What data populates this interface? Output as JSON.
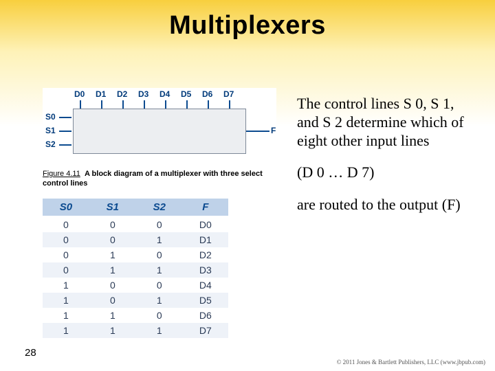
{
  "slide": {
    "title": "Multiplexers",
    "number": "28",
    "copyright": "© 2011 Jones & Bartlett Publishers, LLC (www.jbpub.com)"
  },
  "diagram": {
    "data_inputs": [
      "D0",
      "D1",
      "D2",
      "D3",
      "D4",
      "D5",
      "D6",
      "D7"
    ],
    "select_inputs": [
      "S0",
      "S1",
      "S2"
    ],
    "output_label": "F"
  },
  "caption": {
    "fig_label": "Figure 4.11",
    "text": "A block diagram of a multiplexer with three select control lines"
  },
  "truth_table": {
    "headers": [
      "S0",
      "S1",
      "S2",
      "F"
    ],
    "rows": [
      [
        "0",
        "0",
        "0",
        "D0"
      ],
      [
        "0",
        "0",
        "1",
        "D1"
      ],
      [
        "0",
        "1",
        "0",
        "D2"
      ],
      [
        "0",
        "1",
        "1",
        "D3"
      ],
      [
        "1",
        "0",
        "0",
        "D4"
      ],
      [
        "1",
        "0",
        "1",
        "D5"
      ],
      [
        "1",
        "1",
        "0",
        "D6"
      ],
      [
        "1",
        "1",
        "1",
        "D7"
      ]
    ]
  },
  "body": {
    "p1": "The control lines S 0, S 1, and S 2 determine which of eight other input lines",
    "p2": "(D 0 … D 7)",
    "p3": "are routed to the output (F)"
  },
  "chart_data": {
    "type": "table",
    "title": "8-to-1 multiplexer truth table",
    "columns": [
      "S0",
      "S1",
      "S2",
      "F"
    ],
    "rows": [
      {
        "S0": 0,
        "S1": 0,
        "S2": 0,
        "F": "D0"
      },
      {
        "S0": 0,
        "S1": 0,
        "S2": 1,
        "F": "D1"
      },
      {
        "S0": 0,
        "S1": 1,
        "S2": 0,
        "F": "D2"
      },
      {
        "S0": 0,
        "S1": 1,
        "S2": 1,
        "F": "D3"
      },
      {
        "S0": 1,
        "S1": 0,
        "S2": 0,
        "F": "D4"
      },
      {
        "S0": 1,
        "S1": 0,
        "S2": 1,
        "F": "D5"
      },
      {
        "S0": 1,
        "S1": 1,
        "S2": 0,
        "F": "D6"
      },
      {
        "S0": 1,
        "S1": 1,
        "S2": 1,
        "F": "D7"
      }
    ]
  }
}
